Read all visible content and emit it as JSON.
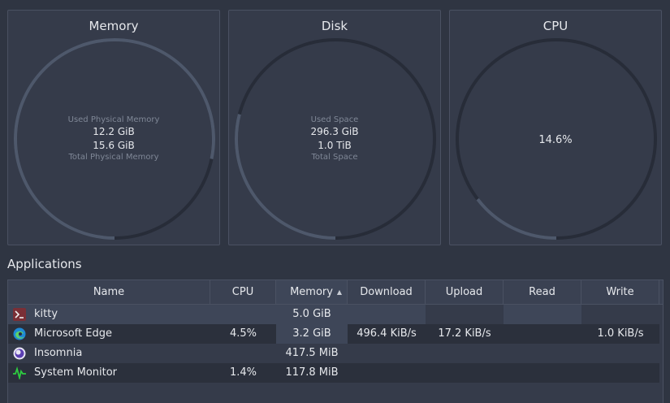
{
  "memory": {
    "title": "Memory",
    "used_label": "Used Physical Memory",
    "used_value": "12.2 GiB",
    "total_value": "15.6 GiB",
    "total_label": "Total Physical Memory",
    "fraction": 0.782
  },
  "disk": {
    "title": "Disk",
    "used_label": "Used Space",
    "used_value": "296.3 GiB",
    "total_value": "1.0 TiB",
    "total_label": "Total Space",
    "fraction": 0.29
  },
  "cpu": {
    "title": "CPU",
    "value": "14.6%",
    "fraction": 0.146
  },
  "applications": {
    "title": "Applications",
    "columns": [
      "Name",
      "CPU",
      "Memory",
      "Download",
      "Upload",
      "Read",
      "Write"
    ],
    "sorted_column": "Memory",
    "rows": [
      {
        "icon": "kitty-terminal-icon",
        "name": "kitty",
        "cpu": "",
        "memory": "5.0 GiB",
        "download": "",
        "upload": "",
        "read": "",
        "write": ""
      },
      {
        "icon": "microsoft-edge-icon",
        "name": "Microsoft Edge",
        "cpu": "4.5%",
        "memory": "3.2 GiB",
        "download": "496.4 KiB/s",
        "upload": "17.2 KiB/s",
        "read": "",
        "write": "1.0 KiB/s"
      },
      {
        "icon": "insomnia-icon",
        "name": "Insomnia",
        "cpu": "",
        "memory": "417.5 MiB",
        "download": "",
        "upload": "",
        "read": "",
        "write": ""
      },
      {
        "icon": "system-monitor-icon",
        "name": "System Monitor",
        "cpu": "1.4%",
        "memory": "117.8 MiB",
        "download": "",
        "upload": "",
        "read": "",
        "write": ""
      }
    ]
  },
  "colors": {
    "background": "#2f3542",
    "card": "#353b4a",
    "gauge_track": "#272c38",
    "gauge_fill": "#4e586b",
    "row_highlight": "#3e4658",
    "alt_row": "#2b303c"
  }
}
